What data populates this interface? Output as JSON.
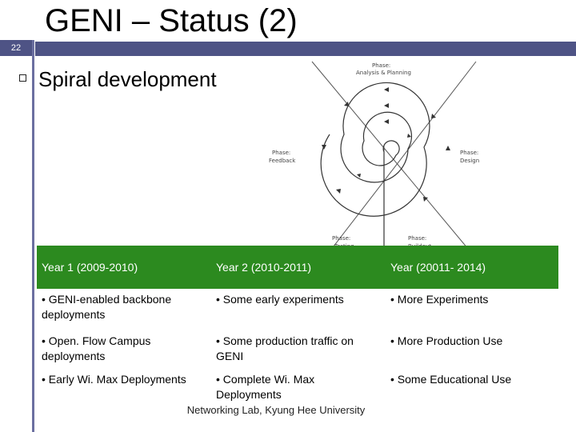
{
  "slide": {
    "title": "GENI – Status (2)",
    "number": "22",
    "bullet": "Spiral development",
    "footer": "Networking Lab, Kyung Hee University"
  },
  "diagram": {
    "phases": [
      {
        "name": "Phase:",
        "sub": "Analysis & Planning"
      },
      {
        "name": "Phase:",
        "sub": "Design"
      },
      {
        "name": "Phase:",
        "sub": "Feedback"
      },
      {
        "name": "Phase:",
        "sub": "Testing"
      },
      {
        "name": "Phase:",
        "sub": "Buildout"
      }
    ]
  },
  "table": {
    "headers": [
      "Year 1 (2009-2010)",
      "Year 2 (2010-2011)",
      "Year (20011- 2014)"
    ],
    "rows": [
      [
        "• GENI-enabled backbone deployments",
        "• Some early experiments",
        "• More Experiments"
      ],
      [
        "• Open. Flow Campus deployments",
        "• Some production traffic on GENI",
        "• More Production Use"
      ],
      [
        "• Early Wi. Max Deployments",
        "• Complete Wi. Max Deployments",
        "• Some Educational Use"
      ]
    ]
  }
}
